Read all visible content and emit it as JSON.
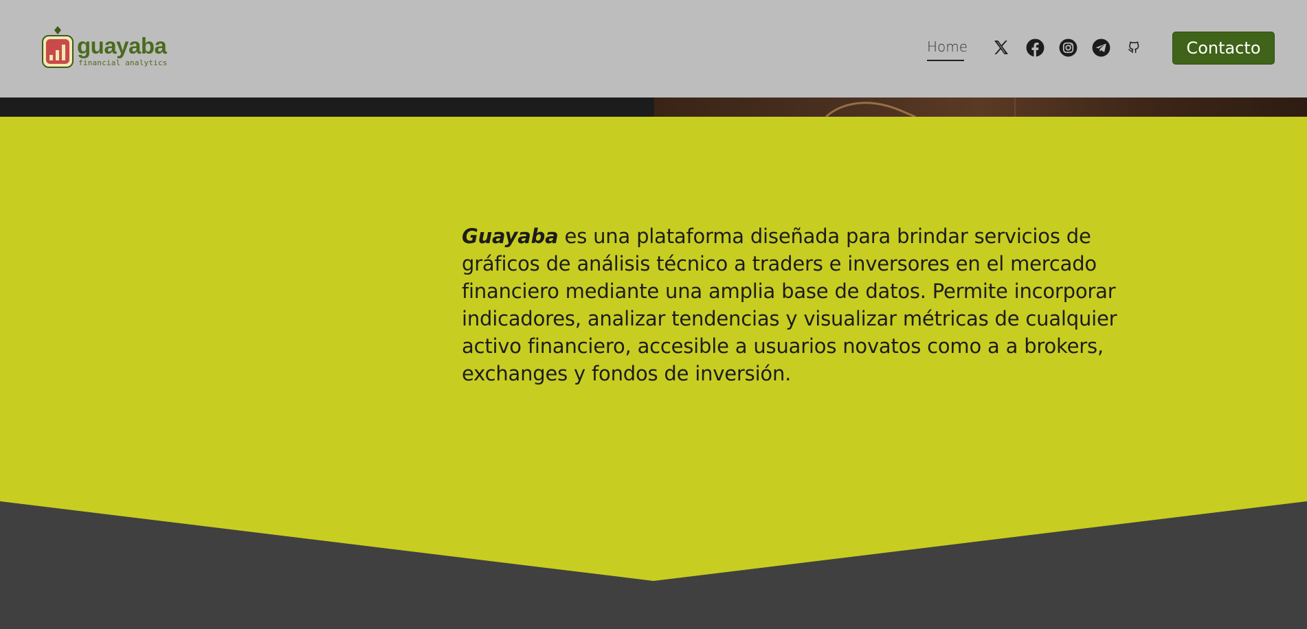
{
  "brand": {
    "name": "guayaba",
    "tagline": "financial analytics"
  },
  "nav": {
    "home_label": "Home",
    "contact_label": "Contacto"
  },
  "social": [
    "x-icon",
    "facebook-icon",
    "instagram-icon",
    "telegram-icon",
    "github-icon"
  ],
  "hero": {
    "brand_word": "Guayaba",
    "description": " es una plataforma diseñada para brindar servicios de gráficos de análisis técnico a traders e inversores en el mercado financiero mediante una amplia base de datos. Permite incorporar indicadores, analizar tendencias y visualizar métricas de cualquier activo financiero, accesible a usuarios novatos como a a brokers, exchanges y fondos de inversión."
  },
  "colors": {
    "header_bg": "#bdbdbd",
    "brand_green": "#4a6b1e",
    "button_green": "#3f6318",
    "hero_lime": "#c8cd22",
    "footer_gray": "#404040"
  }
}
